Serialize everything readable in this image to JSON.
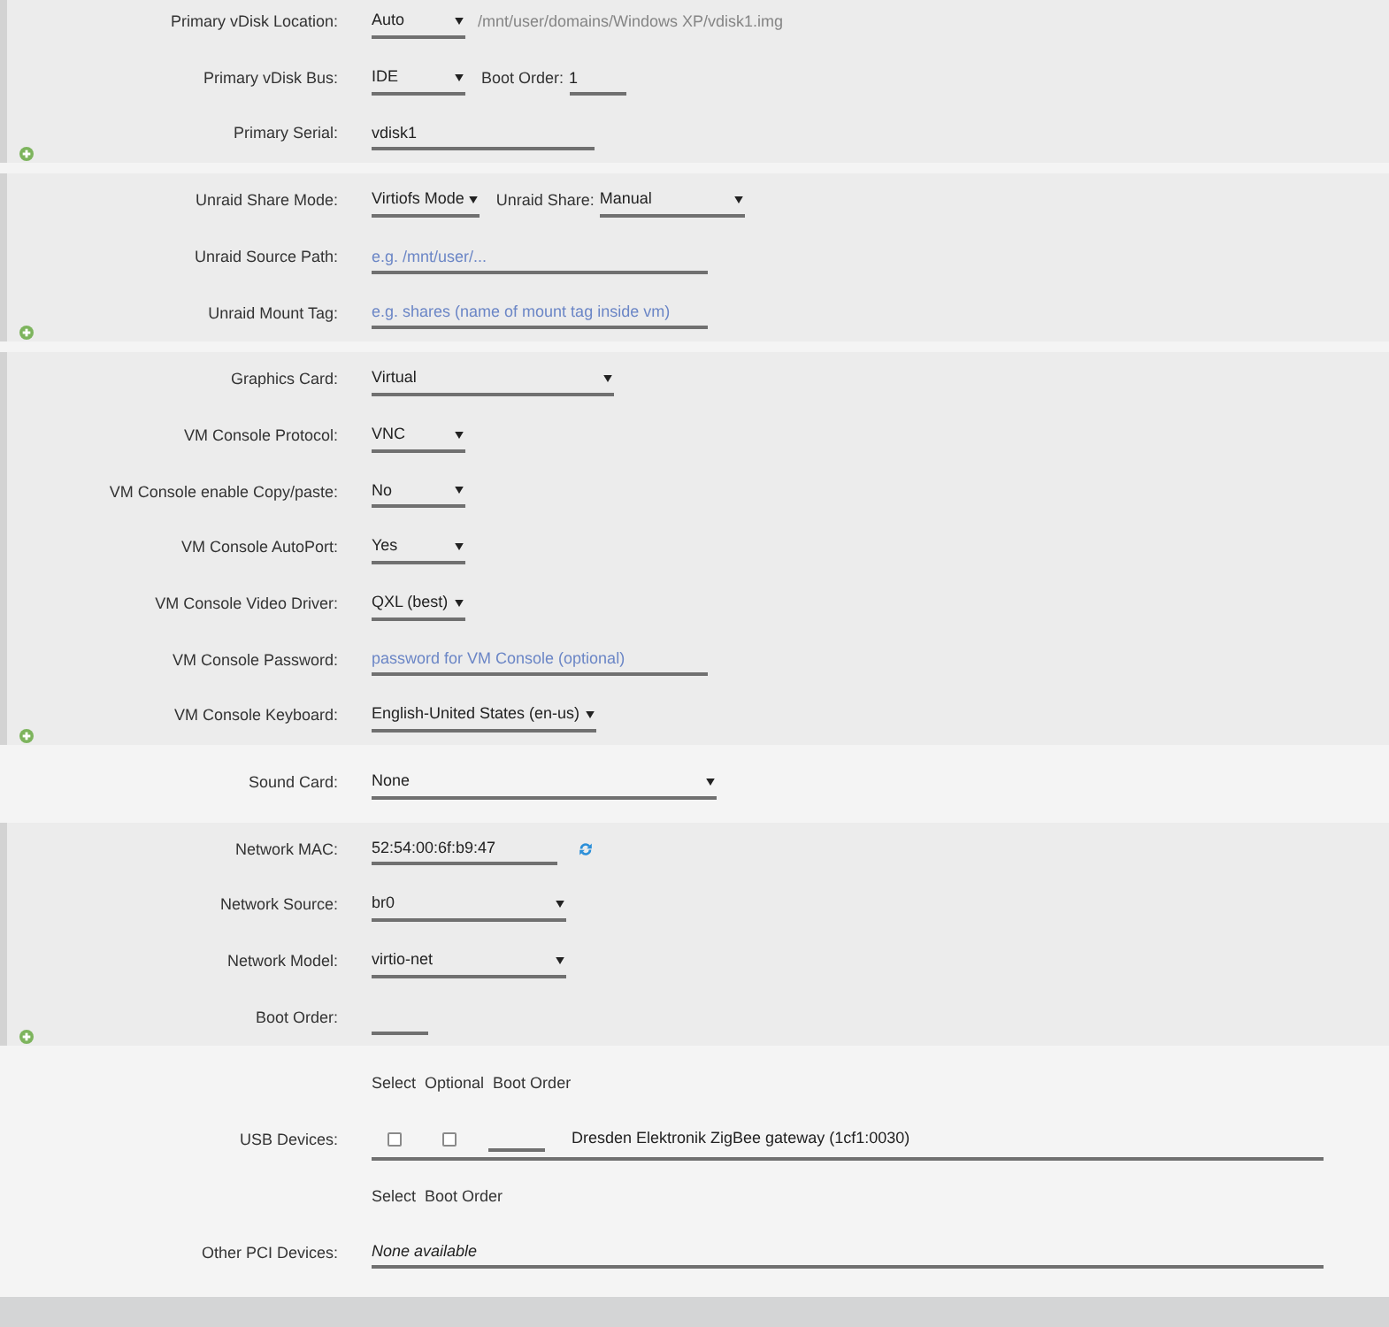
{
  "sections": [
    {
      "kind": "panel",
      "rows": [
        {
          "label": "Primary vDisk Location:",
          "controls": [
            {
              "kind": "select",
              "value": "Auto"
            },
            {
              "kind": "hint",
              "text": "/mnt/user/domains/Windows XP/vdisk1.img"
            }
          ]
        },
        {
          "label": "Primary vDisk Bus:",
          "controls": [
            {
              "kind": "select",
              "value": "IDE"
            },
            {
              "kind": "label",
              "text": "Boot Order:"
            },
            {
              "kind": "input",
              "value": "1"
            }
          ]
        },
        {
          "label": "Primary Serial:",
          "controls": [
            {
              "kind": "input",
              "value": "vdisk1"
            }
          ]
        }
      ]
    },
    {
      "kind": "panel",
      "rows": [
        {
          "label": "Unraid Share Mode:",
          "controls": [
            {
              "kind": "select",
              "value": "Virtiofs Mode"
            },
            {
              "kind": "label",
              "text": "Unraid Share:"
            },
            {
              "kind": "select",
              "value": "Manual"
            }
          ]
        },
        {
          "label": "Unraid Source Path:",
          "controls": [
            {
              "kind": "input",
              "placeholder": "e.g. /mnt/user/..."
            }
          ]
        },
        {
          "label": "Unraid Mount Tag:",
          "controls": [
            {
              "kind": "input",
              "placeholder": "e.g. shares (name of mount tag inside vm)"
            }
          ]
        }
      ]
    },
    {
      "kind": "panel",
      "rows": [
        {
          "label": "Graphics Card:",
          "controls": [
            {
              "kind": "select",
              "value": "Virtual"
            }
          ]
        },
        {
          "label": "VM Console Protocol:",
          "controls": [
            {
              "kind": "select",
              "value": "VNC"
            }
          ]
        },
        {
          "label": "VM Console enable Copy/paste:",
          "controls": [
            {
              "kind": "select",
              "value": "No"
            }
          ]
        },
        {
          "label": "VM Console AutoPort:",
          "controls": [
            {
              "kind": "select",
              "value": "Yes"
            }
          ]
        },
        {
          "label": "VM Console Video Driver:",
          "controls": [
            {
              "kind": "select",
              "value": "QXL (best)"
            }
          ]
        },
        {
          "label": "VM Console Password:",
          "controls": [
            {
              "kind": "input",
              "placeholder": "password for VM Console (optional)"
            }
          ]
        },
        {
          "label": "VM Console Keyboard:",
          "controls": [
            {
              "kind": "select",
              "value": "English-United States (en-us)"
            }
          ]
        }
      ]
    },
    {
      "kind": "plain",
      "rows": [
        {
          "label": "Sound Card:",
          "controls": [
            {
              "kind": "select",
              "value": "None"
            }
          ]
        }
      ]
    },
    {
      "kind": "panel",
      "rows": [
        {
          "label": "Network MAC:",
          "controls": [
            {
              "kind": "input",
              "value": "52:54:00:6f:b9:47"
            },
            {
              "kind": "refresh"
            }
          ]
        },
        {
          "label": "Network Source:",
          "controls": [
            {
              "kind": "select",
              "value": "br0"
            }
          ]
        },
        {
          "label": "Network Model:",
          "controls": [
            {
              "kind": "select",
              "value": "virtio-net"
            }
          ]
        },
        {
          "label": "Boot Order:",
          "controls": [
            {
              "kind": "input"
            }
          ]
        }
      ]
    },
    {
      "kind": "plain",
      "rows": [
        {
          "controls": [
            {
              "kind": "headings",
              "items": [
                "Select",
                "Optional",
                "Boot Order"
              ]
            }
          ]
        },
        {
          "label": "USB Devices:",
          "controls": [
            {
              "kind": "device",
              "checkboxes": [
                {
                  "checked": false
                },
                {
                  "checked": false
                }
              ],
              "name": "Dresden Elektronik ZigBee gateway (1cf1:0030)"
            }
          ]
        },
        {
          "controls": [
            {
              "kind": "headings",
              "items": [
                "Select",
                "Boot Order"
              ]
            }
          ]
        },
        {
          "label": "Other PCI Devices:",
          "controls": [
            {
              "kind": "note",
              "text": "None available"
            }
          ]
        }
      ]
    }
  ]
}
